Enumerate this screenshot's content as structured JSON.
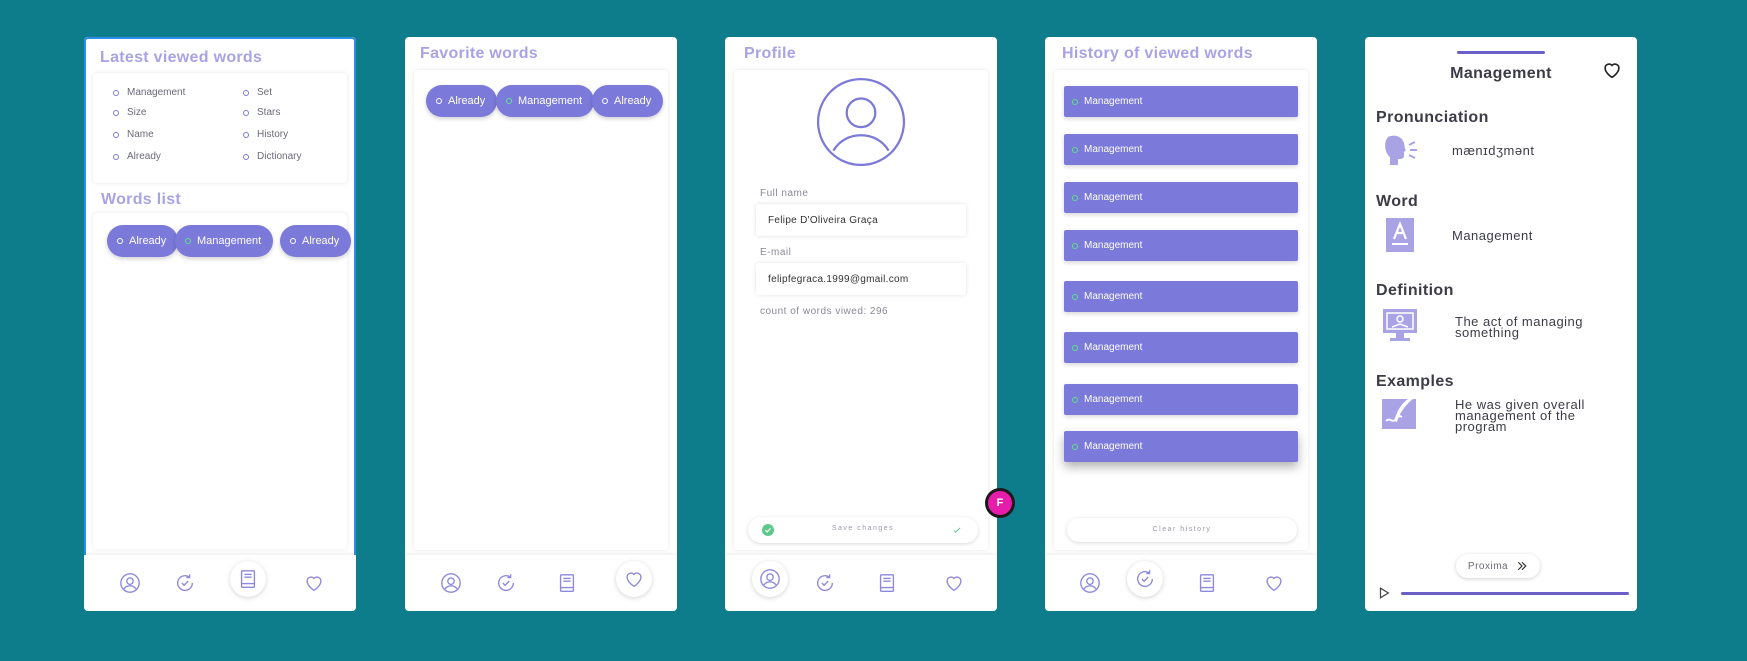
{
  "screen1": {
    "latest_title": "Latest viewed words",
    "latest_words": [
      "Management",
      "Set",
      "Size",
      "Stars",
      "Name",
      "History",
      "Already",
      "Dictionary"
    ],
    "words_list_title": "Words list",
    "chips": [
      "Already",
      "Management",
      "Already"
    ]
  },
  "screen2": {
    "title": "Favorite words",
    "chips": [
      "Already",
      "Management",
      "Already"
    ]
  },
  "screen3": {
    "title": "Profile",
    "full_name_label": "Full name",
    "full_name_value": "Felipe D'Oliveira Graça",
    "email_label": "E-mail",
    "email_value": "felipfegraca.1999@gmail.com",
    "count_text": "count of words viwed: 296",
    "save_label": "Save changes",
    "avatar_letter": "F"
  },
  "screen4": {
    "title": "History of viewed words",
    "items": [
      "Management",
      "Management",
      "Management",
      "Management",
      "Management",
      "Management",
      "Management",
      "Management"
    ],
    "clear_label": "Clear history"
  },
  "screen5": {
    "word_title": "Management",
    "pronunciation_heading": "Pronunciation",
    "pronunciation_value": "mænɪdʒmənt",
    "word_heading": "Word",
    "word_value": "Management",
    "definition_heading": "Definition",
    "definition_value": "The act of managing something",
    "examples_heading": "Examples",
    "examples_value": "He was given overall management of the program",
    "next_label": "Proxima"
  },
  "nav": {
    "items": [
      "profile-icon",
      "history-icon",
      "book-icon",
      "heart-icon"
    ]
  },
  "colors": {
    "background": "#0d7d8c",
    "accent": "#7b79d9",
    "title": "#a9a3e6",
    "selection": "#2f8ee8",
    "cursor_badge": "#e61cab"
  }
}
